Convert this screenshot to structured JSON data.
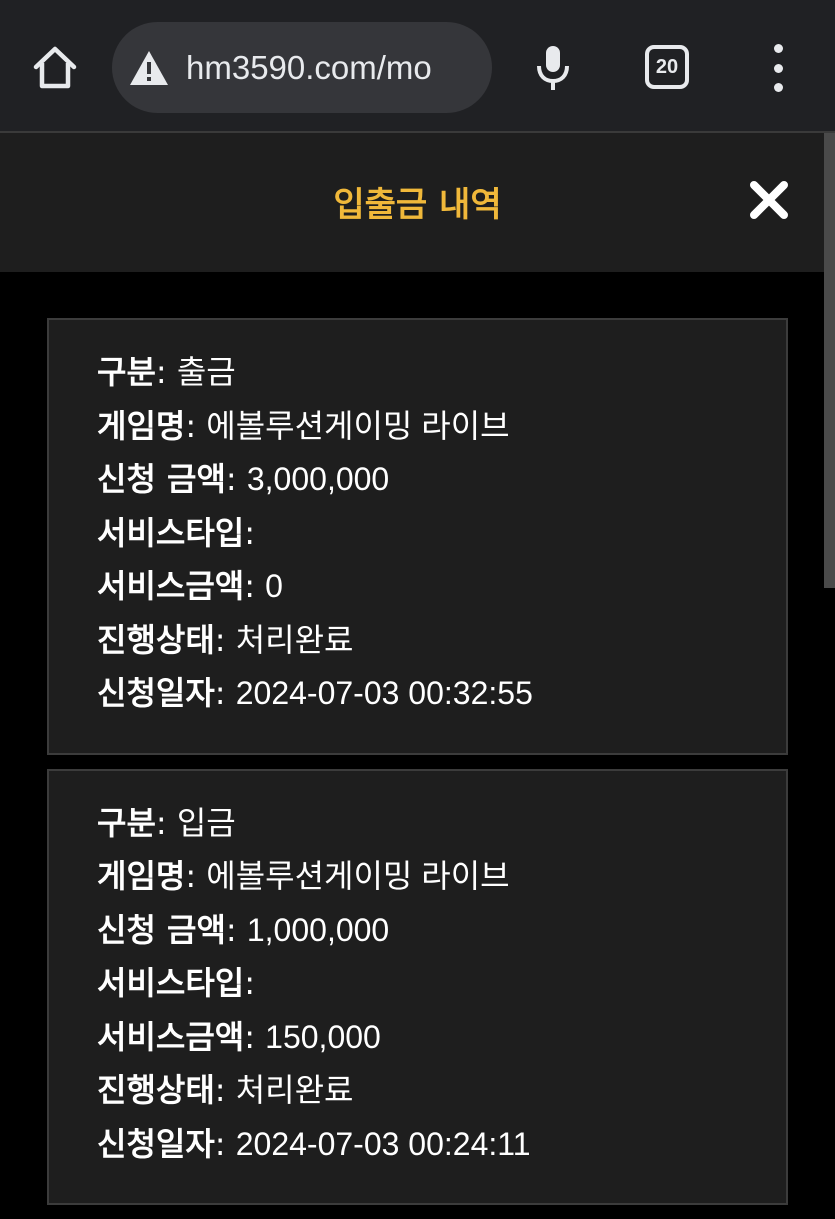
{
  "browser": {
    "url": "hm3590.com/mo",
    "tab_count": "20",
    "icons": {
      "home": "home-icon",
      "security": "warning-icon",
      "voice": "mic-icon",
      "tabs": "tab-switcher-icon",
      "menu": "more-vert-icon"
    }
  },
  "modal": {
    "title": "입출금 내역",
    "close_icon": "close-icon"
  },
  "records": [
    {
      "type_label": "구분",
      "type": "출금",
      "game_label": "게임명",
      "game": "에볼루션게이밍 라이브",
      "amount_label": "신청 금액",
      "amount": "3,000,000",
      "service_type_label": "서비스타입",
      "service_type": "",
      "service_amount_label": "서비스금액",
      "service_amount": "0",
      "status_label": "진행상태",
      "status": "처리완료",
      "date_label": "신청일자",
      "date": "2024-07-03 00:32:55"
    },
    {
      "type_label": "구분",
      "type": "입금",
      "game_label": "게임명",
      "game": "에볼루션게이밍 라이브",
      "amount_label": "신청 금액",
      "amount": "1,000,000",
      "service_type_label": "서비스타입",
      "service_type": "",
      "service_amount_label": "서비스금액",
      "service_amount": "150,000",
      "status_label": "진행상태",
      "status": "처리완료",
      "date_label": "신청일자",
      "date": "2024-07-03 00:24:11"
    }
  ],
  "colors": {
    "accent": "#f0b83a",
    "background": "#000000",
    "card": "#1e1e1e",
    "toolbar": "#202124"
  }
}
